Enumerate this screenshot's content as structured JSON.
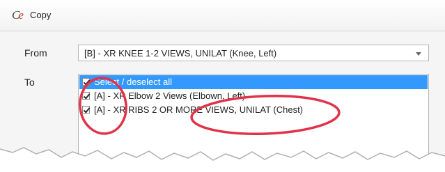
{
  "window": {
    "title": "Copy",
    "icon": "app-logo-icon"
  },
  "form": {
    "from_label": "From",
    "to_label": "To",
    "from_value": "[B] - XR KNEE 1-2 VIEWS, UNILAT (Knee, Left)"
  },
  "list": {
    "select_all": "Select / deselect all",
    "items": [
      {
        "label": "[A] - XR Elbow 2 Views (Elbown, Left)",
        "checked": true
      },
      {
        "label": "[A] - XR RIBS 2 OR MORE VIEWS, UNILAT (Chest)",
        "checked": true
      }
    ]
  },
  "colors": {
    "selection": "#3399ff",
    "annotation": "#e0334a"
  }
}
